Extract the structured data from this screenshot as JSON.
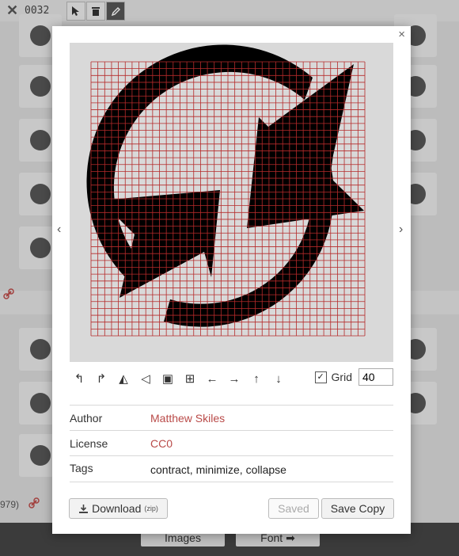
{
  "topbar": {
    "close_glyph": "✕",
    "code": "0032"
  },
  "background": {
    "side_number": "979)",
    "footer_buttons": {
      "images": "Images",
      "font": "Font ➡"
    }
  },
  "modal": {
    "close_glyph": "×",
    "nav_prev": "‹",
    "nav_next": "›",
    "grid": {
      "label": "Grid",
      "value": "40",
      "checked": true
    },
    "meta": [
      {
        "key": "Author",
        "value": "Matthew Skiles",
        "link": true
      },
      {
        "key": "License",
        "value": "CC0",
        "link": true
      },
      {
        "key": "Tags",
        "value": "contract, minimize, collapse",
        "link": false
      }
    ],
    "download": {
      "label": "Download",
      "suffix": "(zip)"
    },
    "saved_label": "Saved",
    "save_copy_label": "Save Copy"
  },
  "colors": {
    "accent_red": "#b94a48",
    "grid_line": "#b52a2a",
    "glyph": "#000000"
  }
}
